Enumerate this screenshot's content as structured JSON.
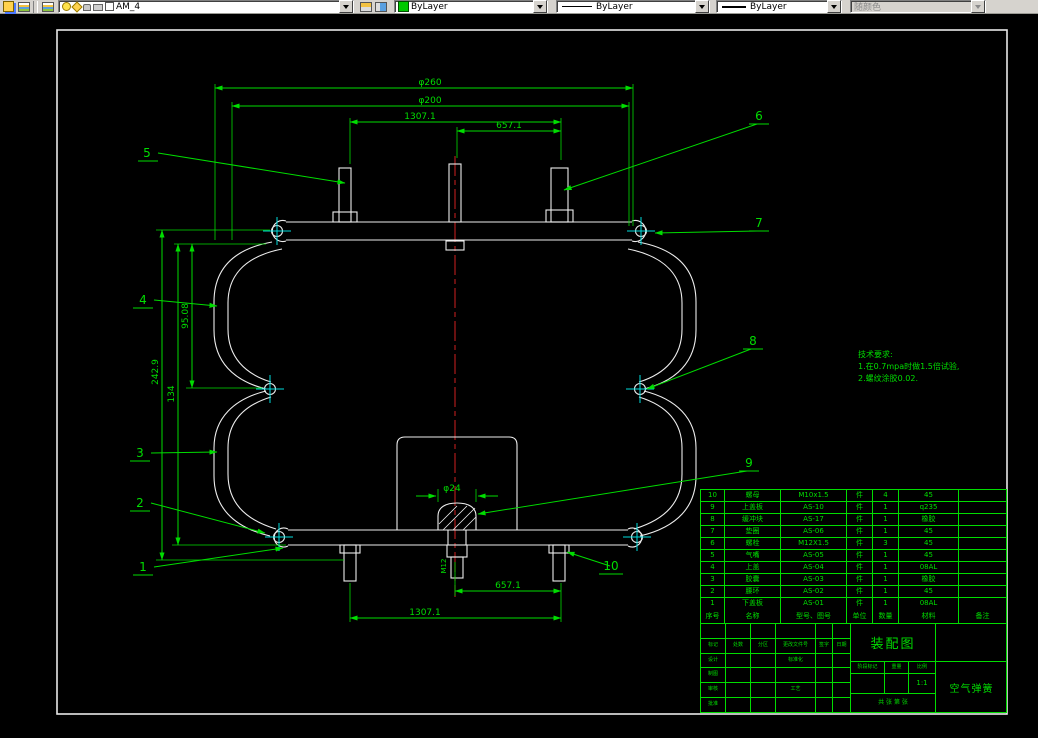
{
  "toolbar": {
    "layer": "AM_4",
    "color": "ByLayer",
    "linetype": "ByLayer",
    "lineweight": "ByLayer",
    "plotstyle": "随颜色"
  },
  "drawing": {
    "dims": {
      "d260": "φ260",
      "d200": "φ200",
      "len1307_top": "1307.1",
      "len657_top": "657.1",
      "len657_bottom": "657.1",
      "len1307_bottom": "1307.1",
      "h242": "242.9",
      "h134": "134",
      "h95": "95.08",
      "d24": "φ24",
      "m12": "M12"
    },
    "balloons": {
      "b1": "1",
      "b2": "2",
      "b3": "3",
      "b4": "4",
      "b5": "5",
      "b6": "6",
      "b7": "7",
      "b8": "8",
      "b9": "9",
      "b10": "10"
    },
    "notes": {
      "l1": "技术要求:",
      "l2": "1.在0.7mpa时做1.5倍试验,",
      "l3": "2.螺纹涂胶0.02."
    }
  },
  "bom": {
    "headers": [
      "序号",
      "名称",
      "型号、图号",
      "单位",
      "数量",
      "材料",
      "备注"
    ],
    "rows": [
      {
        "no": "10",
        "name": "螺母",
        "model": "M10x1.5",
        "unit": "件",
        "qty": "4",
        "material": "45",
        "remark": ""
      },
      {
        "no": "9",
        "name": "上盖板",
        "model": "AS-10",
        "unit": "件",
        "qty": "1",
        "material": "q235",
        "remark": ""
      },
      {
        "no": "8",
        "name": "缓冲块",
        "model": "AS-17",
        "unit": "件",
        "qty": "1",
        "material": "橡胶",
        "remark": ""
      },
      {
        "no": "7",
        "name": "垫圈",
        "model": "AS-06",
        "unit": "件",
        "qty": "1",
        "material": "45",
        "remark": ""
      },
      {
        "no": "6",
        "name": "螺栓",
        "model": "M12X1.5",
        "unit": "件",
        "qty": "3",
        "material": "45",
        "remark": ""
      },
      {
        "no": "5",
        "name": "气嘴",
        "model": "AS-05",
        "unit": "件",
        "qty": "1",
        "material": "45",
        "remark": ""
      },
      {
        "no": "4",
        "name": "上盖",
        "model": "AS-04",
        "unit": "件",
        "qty": "1",
        "material": "08AL",
        "remark": ""
      },
      {
        "no": "3",
        "name": "胶囊",
        "model": "AS-03",
        "unit": "件",
        "qty": "1",
        "material": "橡胶",
        "remark": ""
      },
      {
        "no": "2",
        "name": "腰环",
        "model": "AS-02",
        "unit": "件",
        "qty": "1",
        "material": "45",
        "remark": ""
      },
      {
        "no": "1",
        "name": "下盖板",
        "model": "AS-01",
        "unit": "件",
        "qty": "1",
        "material": "08AL",
        "remark": ""
      }
    ]
  },
  "titleblock": {
    "title": "装配图",
    "product": "空气弹簧",
    "scale_value": "1:1",
    "labels": {
      "mark": "标记",
      "count": "处数",
      "zone": "分区",
      "doc": "更改文件号",
      "sign": "签字",
      "date": "日期",
      "design": "设计",
      "draft": "制图",
      "check": "审核",
      "std": "标准化",
      "craft": "工艺",
      "approve": "批准",
      "stage": "阶段标记",
      "weight": "重量",
      "scale": "比例",
      "sheets": "共 张 第 张"
    }
  }
}
